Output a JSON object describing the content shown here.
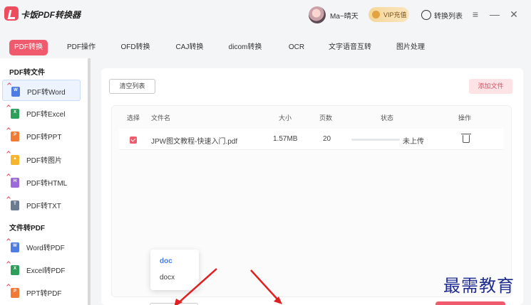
{
  "app": {
    "title": "卡饭PDF转换器"
  },
  "header": {
    "username": "Ma~晴天",
    "vip_label": "VIP充值",
    "convert_list_label": "转换列表",
    "minimize_glyph": "—",
    "menu_glyph": "≡",
    "close_glyph": "✕"
  },
  "tabs": [
    {
      "label": "PDF转换",
      "active": true
    },
    {
      "label": "PDF操作"
    },
    {
      "label": "OFD转换"
    },
    {
      "label": "CAJ转换"
    },
    {
      "label": "dicom转换"
    },
    {
      "label": "OCR"
    },
    {
      "label": "文字语音互转"
    },
    {
      "label": "图片处理"
    }
  ],
  "sidebar": {
    "group1": "PDF转文件",
    "group2": "文件转PDF",
    "items": [
      {
        "label": "PDF转Word",
        "icon": "W",
        "color": "#4f7ce3",
        "active": true
      },
      {
        "label": "PDF转Excel",
        "icon": "X",
        "color": "#2e9e5b"
      },
      {
        "label": "PDF转PPT",
        "icon": "P",
        "color": "#f07a36"
      },
      {
        "label": "PDF转图片",
        "icon": "▲",
        "color": "#f5b52e"
      },
      {
        "label": "PDF转HTML",
        "icon": "H",
        "color": "#9d6ad9"
      },
      {
        "label": "PDF转TXT",
        "icon": "T",
        "color": "#6b7a8f"
      },
      {
        "label": "Word转PDF",
        "icon": "W",
        "color": "#4f7ce3"
      },
      {
        "label": "Excel转PDF",
        "icon": "X",
        "color": "#2e9e5b"
      },
      {
        "label": "PPT转PDF",
        "icon": "P",
        "color": "#f07a36"
      }
    ]
  },
  "main": {
    "clear_button": "清空列表",
    "add_button": "添加文件",
    "columns": [
      "选择",
      "文件名",
      "大小",
      "页数",
      "状态",
      "操作"
    ],
    "rows": [
      {
        "filename": "JPW图文教程-快速入门.pdf",
        "size": "1.57MB",
        "pages": "20",
        "status": "未上传",
        "progress": 0
      }
    ]
  },
  "dropdown": {
    "options": [
      "doc",
      "docx"
    ],
    "selected": "doc"
  },
  "watermark": "最需教育",
  "colors": {
    "accent": "#ef5b6c",
    "annotation_arrow": "#e02020"
  }
}
